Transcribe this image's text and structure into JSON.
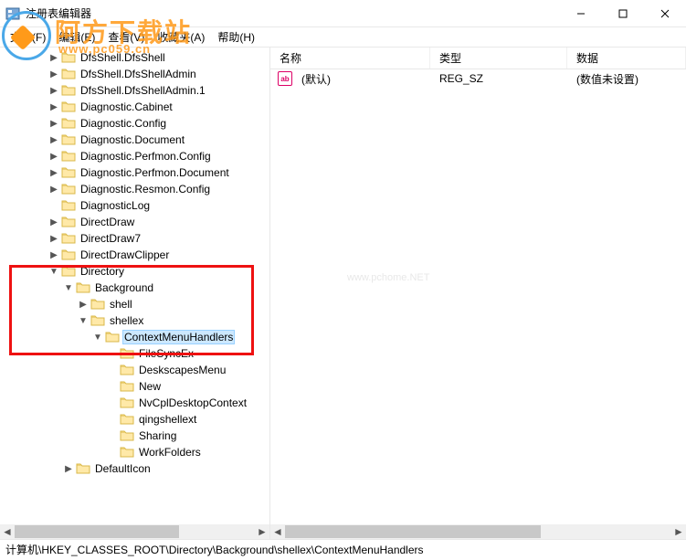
{
  "window": {
    "title": "注册表编辑器",
    "minimize": "—",
    "maximize": "□",
    "close": "✕"
  },
  "menu": [
    {
      "label": "文件(F)"
    },
    {
      "label": "编辑(E)"
    },
    {
      "label": "查看(V)"
    },
    {
      "label": "收藏夹(A)"
    },
    {
      "label": "帮助(H)"
    }
  ],
  "watermark": {
    "line1": "阿方下载站",
    "line2": "www.pc059.cn",
    "mid": "www.pchome.NET"
  },
  "tree": [
    {
      "indent": 3,
      "exp": "closed",
      "label": "DfsShell.DfsShell"
    },
    {
      "indent": 3,
      "exp": "closed",
      "label": "DfsShell.DfsShellAdmin"
    },
    {
      "indent": 3,
      "exp": "closed",
      "label": "DfsShell.DfsShellAdmin.1"
    },
    {
      "indent": 3,
      "exp": "closed",
      "label": "Diagnostic.Cabinet"
    },
    {
      "indent": 3,
      "exp": "closed",
      "label": "Diagnostic.Config"
    },
    {
      "indent": 3,
      "exp": "closed",
      "label": "Diagnostic.Document"
    },
    {
      "indent": 3,
      "exp": "closed",
      "label": "Diagnostic.Perfmon.Config"
    },
    {
      "indent": 3,
      "exp": "closed",
      "label": "Diagnostic.Perfmon.Document"
    },
    {
      "indent": 3,
      "exp": "closed",
      "label": "Diagnostic.Resmon.Config"
    },
    {
      "indent": 3,
      "exp": "none",
      "label": "DiagnosticLog"
    },
    {
      "indent": 3,
      "exp": "closed",
      "label": "DirectDraw"
    },
    {
      "indent": 3,
      "exp": "closed",
      "label": "DirectDraw7"
    },
    {
      "indent": 3,
      "exp": "closed",
      "label": "DirectDrawClipper"
    },
    {
      "indent": 3,
      "exp": "open",
      "label": "Directory"
    },
    {
      "indent": 4,
      "exp": "open",
      "label": "Background"
    },
    {
      "indent": 5,
      "exp": "closed",
      "label": "shell"
    },
    {
      "indent": 5,
      "exp": "open",
      "label": "shellex"
    },
    {
      "indent": 6,
      "exp": "open",
      "label": "ContextMenuHandlers",
      "selected": true
    },
    {
      "indent": 7,
      "exp": "none",
      "label": "FileSyncEx"
    },
    {
      "indent": 7,
      "exp": "none",
      "label": "DeskscapesMenu"
    },
    {
      "indent": 7,
      "exp": "none",
      "label": "New"
    },
    {
      "indent": 7,
      "exp": "none",
      "label": "NvCplDesktopContext"
    },
    {
      "indent": 7,
      "exp": "none",
      "label": "qingshellext"
    },
    {
      "indent": 7,
      "exp": "none",
      "label": "Sharing"
    },
    {
      "indent": 7,
      "exp": "none",
      "label": "WorkFolders"
    },
    {
      "indent": 4,
      "exp": "closed",
      "label": "DefaultIcon"
    }
  ],
  "list": {
    "headers": {
      "name": "名称",
      "type": "类型",
      "data": "数据"
    },
    "cols": {
      "name": 175,
      "type": 150,
      "data": 200
    },
    "rows": [
      {
        "name": "(默认)",
        "type": "REG_SZ",
        "data": "(数值未设置)",
        "icon": "ab"
      }
    ]
  },
  "statusbar": {
    "path": "计算机\\HKEY_CLASSES_ROOT\\Directory\\Background\\shellex\\ContextMenuHandlers"
  }
}
